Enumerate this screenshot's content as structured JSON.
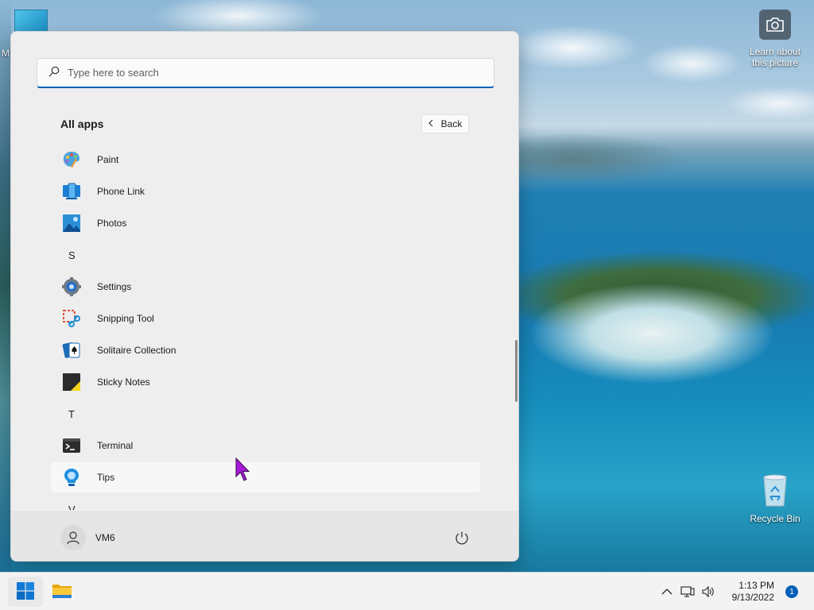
{
  "desktop": {
    "top_icon_label": "M",
    "learn_about": "Learn about this picture",
    "recycle_bin": "Recycle Bin"
  },
  "start_menu": {
    "search_placeholder": "Type here to search",
    "section_title": "All apps",
    "back_label": "Back",
    "apps": [
      {
        "label": "Paint",
        "icon": "paint-icon"
      },
      {
        "label": "Phone Link",
        "icon": "phone-link-icon"
      },
      {
        "label": "Photos",
        "icon": "photos-icon"
      },
      {
        "letter": "S"
      },
      {
        "label": "Settings",
        "icon": "settings-icon"
      },
      {
        "label": "Snipping Tool",
        "icon": "snipping-tool-icon"
      },
      {
        "label": "Solitaire Collection",
        "icon": "solitaire-icon"
      },
      {
        "label": "Sticky Notes",
        "icon": "sticky-notes-icon"
      },
      {
        "letter": "T"
      },
      {
        "label": "Terminal",
        "icon": "terminal-icon"
      },
      {
        "label": "Tips",
        "icon": "tips-icon"
      },
      {
        "letter": "V"
      }
    ],
    "user_name": "VM6"
  },
  "taskbar": {
    "time": "1:13 PM",
    "date": "9/13/2022",
    "notification_count": "1"
  },
  "colors": {
    "accent": "#005fb8",
    "menu_bg": "#eeeeee"
  }
}
